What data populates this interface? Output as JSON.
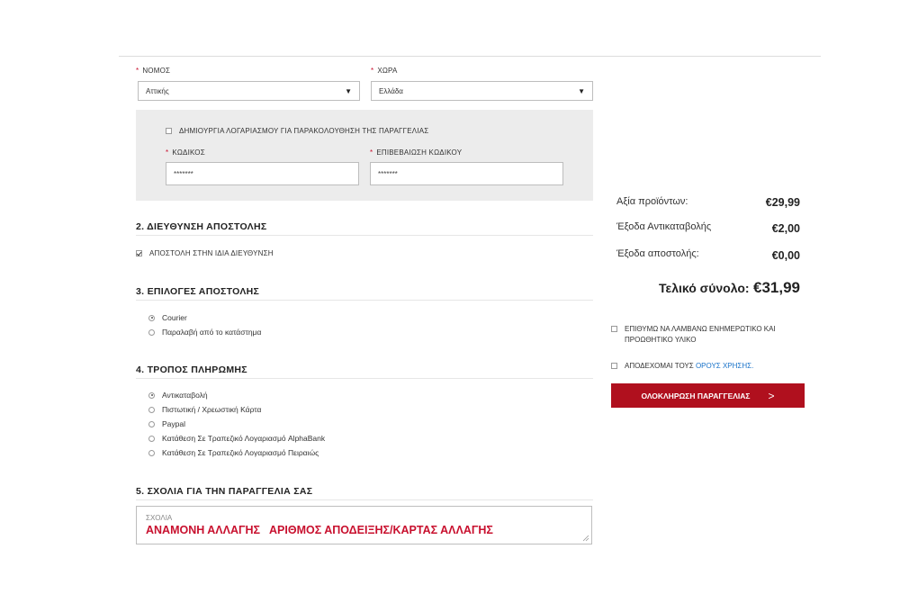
{
  "region": {
    "label": "ΝΟΜΟΣ",
    "value": "Αττικής"
  },
  "country": {
    "label": "ΧΩΡΑ",
    "value": "Ελλάδα"
  },
  "account": {
    "create_label": "ΔΗΜΙΟΥΡΓΙΑ ΛΟΓΑΡΙΑΣΜΟΥ ΓΙΑ ΠΑΡΑΚΟΛΟΥΘΗΣΗ ΤΗΣ ΠΑΡΑΓΓΕΛΙΑΣ",
    "password_label": "ΚΩΔΙΚΟΣ",
    "password_value": "*******",
    "confirm_label": "ΕΠΙΒΕΒΑΙΩΣΗ ΚΩΔΙΚΟΥ",
    "confirm_value": "*******"
  },
  "address": {
    "title": "2. ΔΙΕΥΘΥΝΣΗ ΑΠΟΣΤΟΛΗΣ",
    "same_address_label": "ΑΠΟΣΤΟΛΗ ΣΤΗΝ ΙΔΙΑ ΔΙΕΥΘΥΝΣΗ",
    "same_address_checked": true
  },
  "shipping": {
    "title": "3. ΕΠΙΛΟΓΕΣ ΑΠΟΣΤΟΛΗΣ",
    "options": [
      "Courier",
      "Παραλαβή από το κατάστημα"
    ],
    "selected": 0
  },
  "payment": {
    "title": "4. ΤΡΟΠΟΣ ΠΛΗΡΩΜΗΣ",
    "options": [
      "Αντικαταβολή",
      "Πιστωτική / Χρεωστική Κάρτα",
      "Paypal",
      "Κατάθεση Σε Τραπεζικό Λογαριασμό AlphaBank",
      "Κατάθεση Σε Τραπεζικό Λογαριασμό Πειραιώς"
    ],
    "selected": 0
  },
  "comments": {
    "title": "5. ΣΧΟΛΙΑ ΓΙΑ ΤΗΝ ΠΑΡΑΓΓΕΛΙΑ ΣΑΣ",
    "placeholder": "ΣΧΟΛΙΑ",
    "value": "ΑΝΑΜΟΝΗ ΑΛΛΑΓΗΣ   ΑΡΙΘΜΟΣ ΑΠΟΔΕΙΞΗΣ/ΚΑΡΤΑΣ ΑΛΛΑΓΗΣ"
  },
  "summary": {
    "products_label": "Αξία προϊόντων:",
    "products_value": "€29,99",
    "cod_label": "Έξοδα Αντικαταβολής",
    "cod_value": "€2,00",
    "shipping_label": "Έξοδα αποστολής:",
    "shipping_value": "€0,00",
    "total_label": "Τελικό σύνολο:",
    "total_value": "€31,99"
  },
  "consents": {
    "newsletter_line1": "ΕΠΙΘΥΜΩ ΝΑ ΛΑΜΒΑΝΩ ΕΝΗΜΕΡΩΤΙΚΟ ΚΑΙ",
    "newsletter_line2": "ΠΡΟΩΘΗΤΙΚΟ ΥΛΙΚΟ",
    "terms_prefix": "ΑΠΟΔΕΧΟΜΑΙ ΤΟΥΣ",
    "terms_link": "ΟΡΟΥΣ ΧΡΗΣΗΣ."
  },
  "submit": {
    "label": "ΟΛΟΚΛΗΡΩΣΗ ΠΑΡΑΓΓΕΛΙΑΣ",
    "arrow": ">"
  },
  "colors": {
    "accent": "#b0101e",
    "link": "#1a73c9",
    "comment_text": "#c8102e",
    "panel": "#ececec"
  }
}
